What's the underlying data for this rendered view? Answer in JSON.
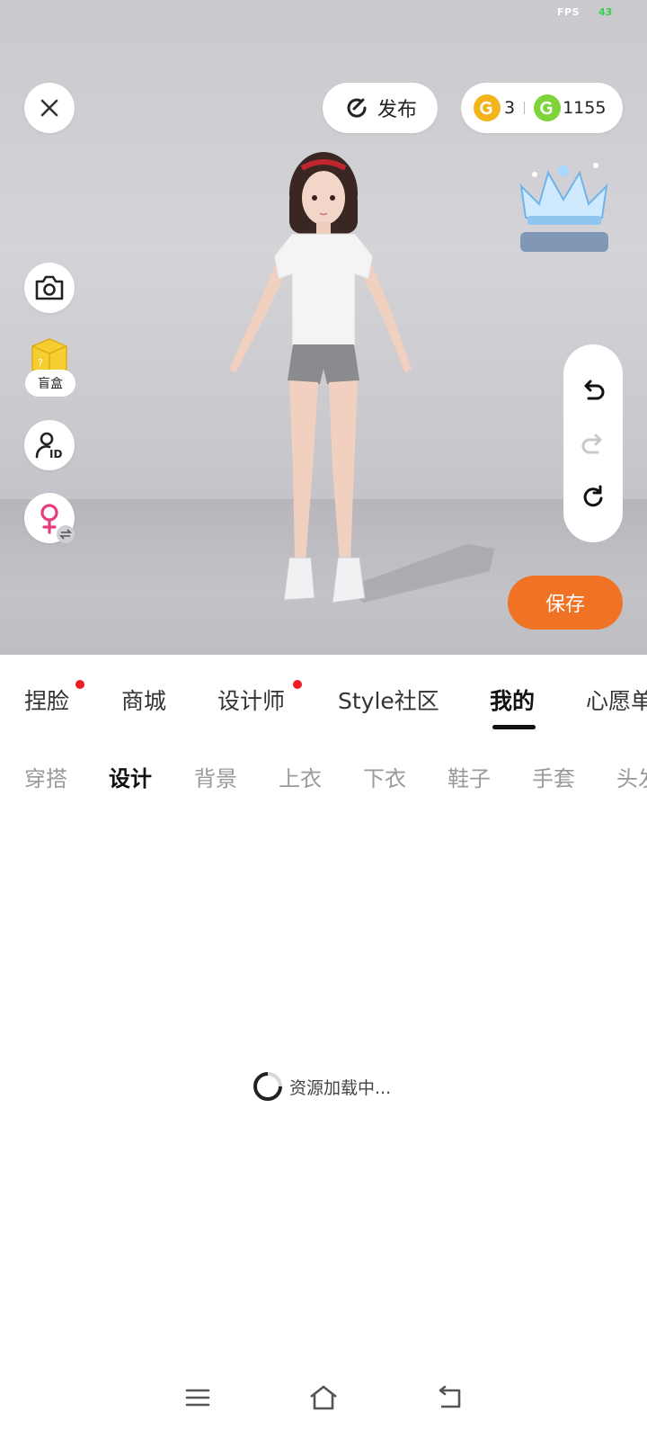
{
  "status": {
    "fps_label": "FPS",
    "fps_value": "43"
  },
  "top_bar": {
    "publish_label": "发布",
    "currency": {
      "gold_count": "3",
      "green_count": "1155"
    }
  },
  "left_tools": {
    "blind_box_label": "盲盒"
  },
  "actions": {
    "save_label": "保存"
  },
  "main_tabs": [
    {
      "label": "捏脸",
      "badge": true
    },
    {
      "label": "商城",
      "badge": false
    },
    {
      "label": "设计师",
      "badge": true
    },
    {
      "label": "Style社区",
      "badge": false
    },
    {
      "label": "我的",
      "badge": false,
      "active": true
    },
    {
      "label": "心愿单",
      "badge": false
    }
  ],
  "sub_tabs": [
    {
      "label": "穿搭"
    },
    {
      "label": "设计",
      "active": true
    },
    {
      "label": "背景"
    },
    {
      "label": "上衣"
    },
    {
      "label": "下衣"
    },
    {
      "label": "鞋子"
    },
    {
      "label": "手套"
    },
    {
      "label": "头发"
    }
  ],
  "loading_text": "资源加载中...",
  "colors": {
    "accent": "#f07224",
    "badge_red": "#ee1b24",
    "gender_pink": "#e53d7d"
  },
  "icons": [
    "close-icon",
    "publish-icon",
    "gold-coin-icon",
    "green-coin-icon",
    "crown-emblem",
    "camera-icon",
    "blind-box-icon",
    "user-id-icon",
    "female-gender-icon",
    "swap-icon",
    "undo-icon",
    "redo-icon",
    "reset-icon",
    "menu-icon",
    "home-icon",
    "back-icon"
  ]
}
